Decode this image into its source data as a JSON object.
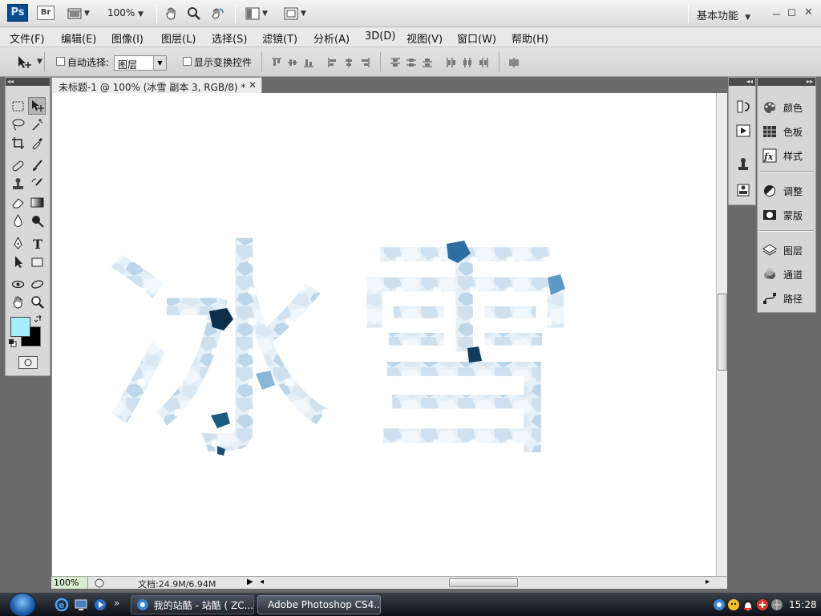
{
  "app": {
    "logo": "Ps",
    "bridge": "Br",
    "zoom": "100%",
    "workspace": "基本功能",
    "window_controls": [
      "－",
      "◻",
      "✕"
    ]
  },
  "menu": [
    "文件(F)",
    "编辑(E)",
    "图像(I)",
    "图层(L)",
    "选择(S)",
    "滤镜(T)",
    "分析(A)",
    "3D(D)",
    "视图(V)",
    "窗口(W)",
    "帮助(H)"
  ],
  "options": {
    "auto_select_label": "自动选择:",
    "auto_select_value": "图层",
    "show_transform_label": "显示变换控件"
  },
  "document": {
    "tab_title": "未标题-1 @ 100% (冰雪 副本 3, RGB/8) *",
    "close": "✕",
    "artwork_text": [
      "冰",
      "雪"
    ]
  },
  "status": {
    "zoom": "100%",
    "doc_info": "文档:24.9M/6.94M"
  },
  "panels": {
    "items": [
      {
        "label": "颜色",
        "icon": "palette-icon"
      },
      {
        "label": "色板",
        "icon": "swatches-icon"
      },
      {
        "label": "样式",
        "icon": "styles-fx-icon"
      },
      {
        "label": "调整",
        "icon": "adjustments-icon"
      },
      {
        "label": "蒙版",
        "icon": "masks-icon"
      },
      {
        "label": "图层",
        "icon": "layers-icon"
      },
      {
        "label": "通道",
        "icon": "channels-icon"
      },
      {
        "label": "路径",
        "icon": "paths-icon"
      }
    ]
  },
  "colors": {
    "foreground": "#a7eefc",
    "background": "#000000"
  },
  "taskbar": {
    "buttons": [
      "我的站酷 - 站酷 ( ZC...",
      "Adobe Photoshop CS4..."
    ],
    "time": "15:28"
  }
}
